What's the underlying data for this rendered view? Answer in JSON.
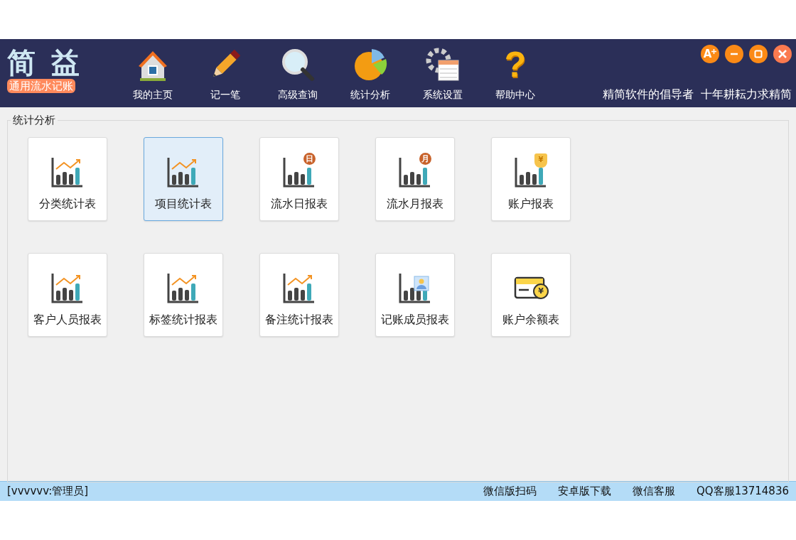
{
  "logo": {
    "title": "简 益",
    "subtitle": "通用流水记账"
  },
  "nav": [
    {
      "label": "我的主页",
      "kind": "house"
    },
    {
      "label": "记一笔",
      "kind": "pencil"
    },
    {
      "label": "高级查询",
      "kind": "search"
    },
    {
      "label": "统计分析",
      "kind": "pie"
    },
    {
      "label": "系统设置",
      "kind": "settings"
    },
    {
      "label": "帮助中心",
      "kind": "help",
      "glyph": "?"
    }
  ],
  "window_controls": [
    {
      "kind": "font",
      "label": "A"
    },
    {
      "kind": "minimize"
    },
    {
      "kind": "maximize"
    },
    {
      "kind": "close"
    }
  ],
  "slogans": [
    "精简软件的倡导者",
    "十年耕耘力求精简"
  ],
  "group": {
    "title": "统计分析",
    "tiles": [
      {
        "label": "分类统计表",
        "kind": "chart",
        "selected": false
      },
      {
        "label": "项目统计表",
        "kind": "chart",
        "selected": true
      },
      {
        "label": "流水日报表",
        "kind": "dated",
        "badge": "日",
        "selected": false
      },
      {
        "label": "流水月报表",
        "kind": "dated",
        "badge": "月",
        "selected": false
      },
      {
        "label": "账户报表",
        "kind": "shield",
        "badge": "¥",
        "selected": false
      },
      {
        "label": "客户人员报表",
        "kind": "chart",
        "selected": false
      },
      {
        "label": "标签统计报表",
        "kind": "chart",
        "selected": false
      },
      {
        "label": "备注统计报表",
        "kind": "chart",
        "selected": false
      },
      {
        "label": "记账成员报表",
        "kind": "person",
        "selected": false
      },
      {
        "label": "账户余额表",
        "kind": "card",
        "badge": "¥",
        "selected": false
      }
    ]
  },
  "status_bar": {
    "user": "[vvvvvv:管理员]",
    "links": [
      "微信版扫码",
      "安卓版下载",
      "微信客服",
      "QQ客服13714836"
    ]
  }
}
